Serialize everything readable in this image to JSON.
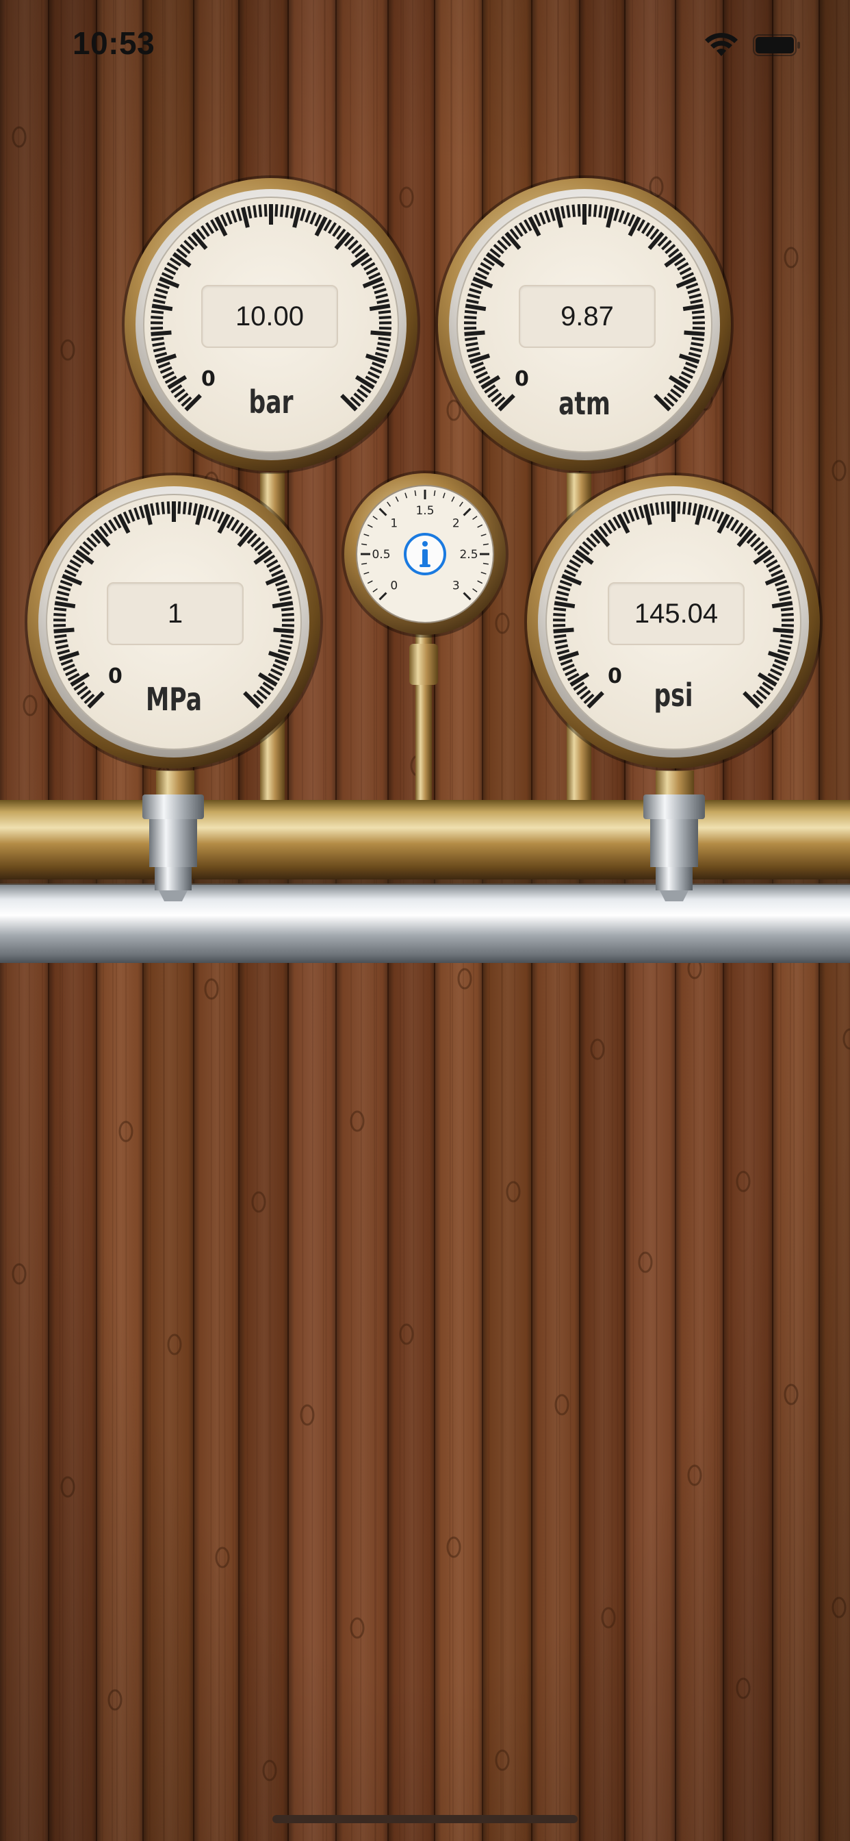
{
  "status_bar": {
    "time": "10:53"
  },
  "gauges": {
    "bar": {
      "value": "10.00",
      "unit": "bar",
      "zero_label": "0"
    },
    "atm": {
      "value": "9.87",
      "unit": "atm",
      "zero_label": "0"
    },
    "mpa": {
      "value": "1",
      "unit": "MPa",
      "zero_label": "0"
    },
    "psi": {
      "value": "145.04",
      "unit": "psi",
      "zero_label": "0"
    }
  },
  "info_gauge": {
    "icon": "info-icon",
    "scale_labels": [
      "0",
      "0.5",
      "1",
      "1.5",
      "2",
      "2.5",
      "3"
    ]
  },
  "colors": {
    "wood": "#7a4324",
    "brass": "#b08a4a",
    "steel": "#c8ccd0",
    "info_blue": "#1a7ae0"
  }
}
